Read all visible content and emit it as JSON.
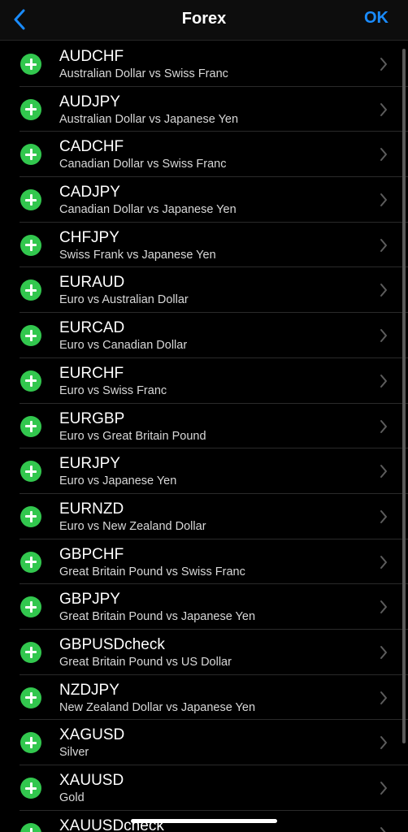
{
  "header": {
    "title": "Forex",
    "ok_label": "OK"
  },
  "colors": {
    "accent": "#1a8cff",
    "add": "#32c74e",
    "background": "#000000"
  },
  "icons": {
    "back": "chevron-left-icon",
    "add": "plus-circle-icon",
    "row_action": "chevron-right-icon"
  },
  "symbols": [
    {
      "symbol": "AUDCHF",
      "description": "Australian Dollar vs Swiss Franc"
    },
    {
      "symbol": "AUDJPY",
      "description": "Australian Dollar vs Japanese Yen"
    },
    {
      "symbol": "CADCHF",
      "description": "Canadian Dollar vs Swiss Franc"
    },
    {
      "symbol": "CADJPY",
      "description": "Canadian Dollar vs Japanese Yen"
    },
    {
      "symbol": "CHFJPY",
      "description": "Swiss Frank vs Japanese Yen"
    },
    {
      "symbol": "EURAUD",
      "description": "Euro vs Australian Dollar"
    },
    {
      "symbol": "EURCAD",
      "description": "Euro vs Canadian Dollar"
    },
    {
      "symbol": "EURCHF",
      "description": "Euro vs Swiss Franc"
    },
    {
      "symbol": "EURGBP",
      "description": "Euro vs Great Britain Pound"
    },
    {
      "symbol": "EURJPY",
      "description": "Euro vs Japanese Yen"
    },
    {
      "symbol": "EURNZD",
      "description": "Euro vs New Zealand Dollar"
    },
    {
      "symbol": "GBPCHF",
      "description": "Great Britain Pound vs Swiss Franc"
    },
    {
      "symbol": "GBPJPY",
      "description": "Great Britain Pound vs Japanese Yen"
    },
    {
      "symbol": "GBPUSDcheck",
      "description": "Great Britain Pound vs US Dollar"
    },
    {
      "symbol": "NZDJPY",
      "description": "New Zealand Dollar vs Japanese Yen"
    },
    {
      "symbol": "XAGUSD",
      "description": "Silver"
    },
    {
      "symbol": "XAUUSD",
      "description": "Gold"
    },
    {
      "symbol": "XAUUSDcheck",
      "description": ""
    }
  ]
}
